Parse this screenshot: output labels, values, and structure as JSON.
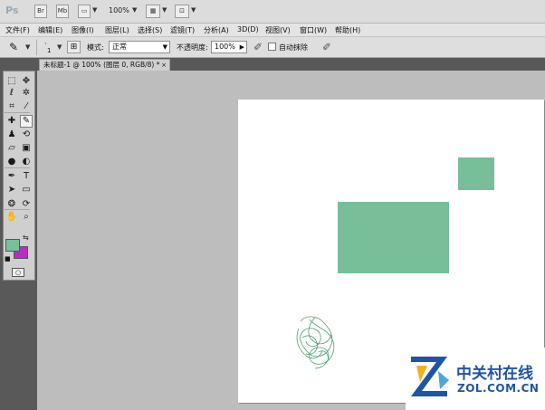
{
  "app": {
    "logo": "Ps",
    "buttons": [
      "Br",
      "Mb"
    ],
    "zoom": "100%"
  },
  "menu": {
    "items": [
      "文件(F)",
      "编辑(E)",
      "图像(I)",
      "图层(L)",
      "选择(S)",
      "滤镜(T)",
      "分析(A)",
      "3D(D)",
      "视图(V)",
      "窗口(W)",
      "帮助(H)"
    ]
  },
  "options": {
    "brush_size": "1",
    "mode_label": "模式:",
    "mode_value": "正常",
    "opacity_label": "不透明度:",
    "opacity_value": "100%",
    "auto_erase_label": "自动抹除"
  },
  "document": {
    "tab_title": "未标题-1 @ 100% (图层 0, RGB/8) *",
    "close": "×"
  },
  "colors": {
    "foreground": "#7abf9c",
    "background": "#b62fc0",
    "shape_fill": "#78bf99",
    "scribble_stroke": "#4f9f71"
  },
  "toolbox": {
    "icons": [
      "marquee-icon",
      "move-icon",
      "lasso-icon",
      "magic-wand-icon",
      "crop-icon",
      "eyedropper-icon",
      "healing-brush-icon",
      "pencil-icon",
      "clone-stamp-icon",
      "history-brush-icon",
      "eraser-icon",
      "gradient-icon",
      "blur-icon",
      "dodge-icon",
      "pen-icon",
      "type-icon",
      "path-selection-icon",
      "rectangle-icon",
      "3d-rotate-icon",
      "3d-orbit-icon",
      "hand-icon",
      "zoom-icon",
      "quick-mask-icon"
    ]
  },
  "watermark": {
    "brand": "中关村在线",
    "url": "ZOL.COM.CN"
  }
}
